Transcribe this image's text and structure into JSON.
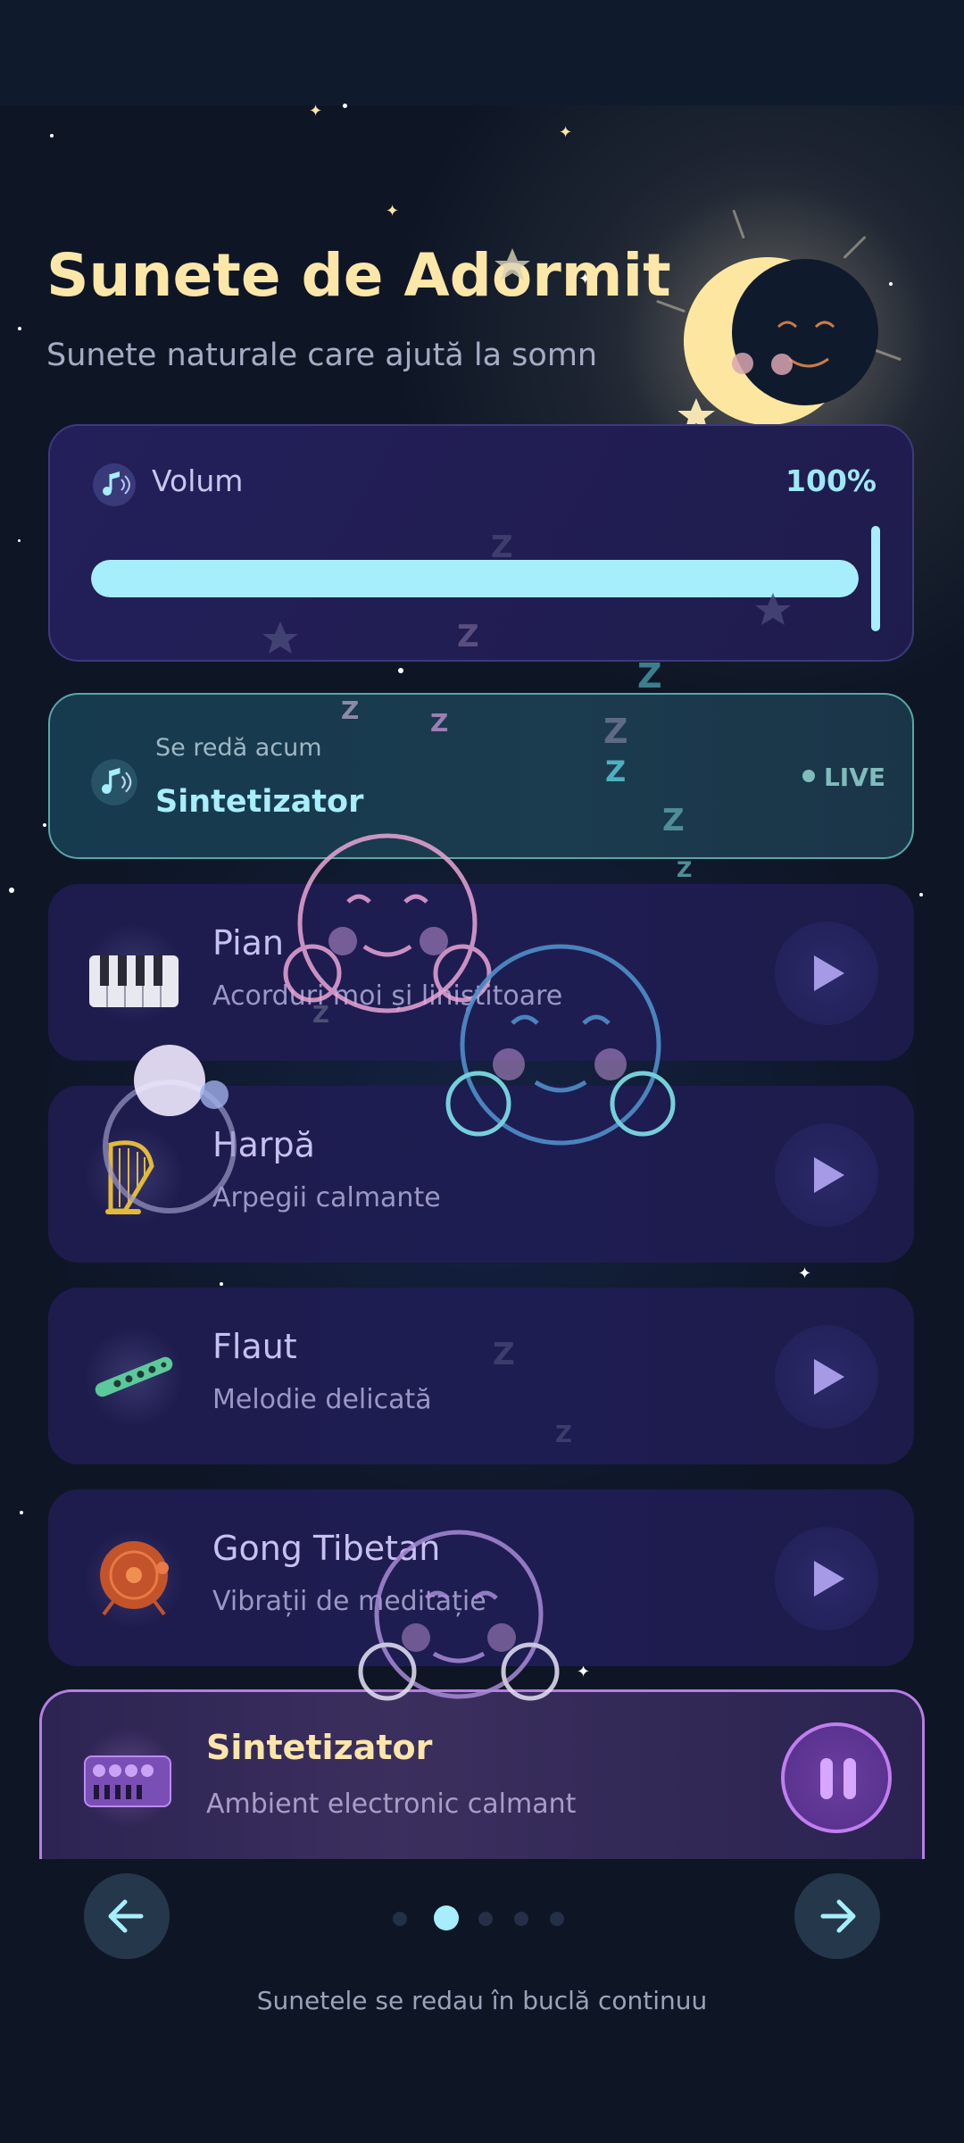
{
  "header": {
    "title": "Sunete de Adormit",
    "subtitle": "Sunete naturale care ajută la somn"
  },
  "volume": {
    "label": "Volum",
    "value_text": "100%",
    "level": 1.0,
    "icon": "music-note-icon"
  },
  "now_playing": {
    "label": "Se redă acum",
    "title": "Sintetizator",
    "badge": "LIVE",
    "icon": "music-note-icon"
  },
  "tracks": [
    {
      "name": "Pian",
      "desc": "Acorduri moi și liniștitoare",
      "icon": "piano-icon",
      "state": "stopped"
    },
    {
      "name": "Harpă",
      "desc": "Arpegii calmante",
      "icon": "harp-icon",
      "state": "stopped"
    },
    {
      "name": "Flaut",
      "desc": "Melodie delicată",
      "icon": "flute-icon",
      "state": "stopped"
    },
    {
      "name": "Gong Tibetan",
      "desc": "Vibrații de meditație",
      "icon": "gong-icon",
      "state": "stopped"
    },
    {
      "name": "Sintetizator",
      "desc": "Ambient electronic calmant",
      "icon": "synth-icon",
      "state": "playing"
    }
  ],
  "pagination": {
    "count": 5,
    "active_index": 1
  },
  "footer": "Sunetele se redau în buclă continuu",
  "colors": {
    "background": "#0e1626",
    "accent_cyan": "#a6eefc",
    "title_yellow": "#fde7a8",
    "card_purple": "#1e1c4c",
    "active_border": "#b77ee2"
  }
}
